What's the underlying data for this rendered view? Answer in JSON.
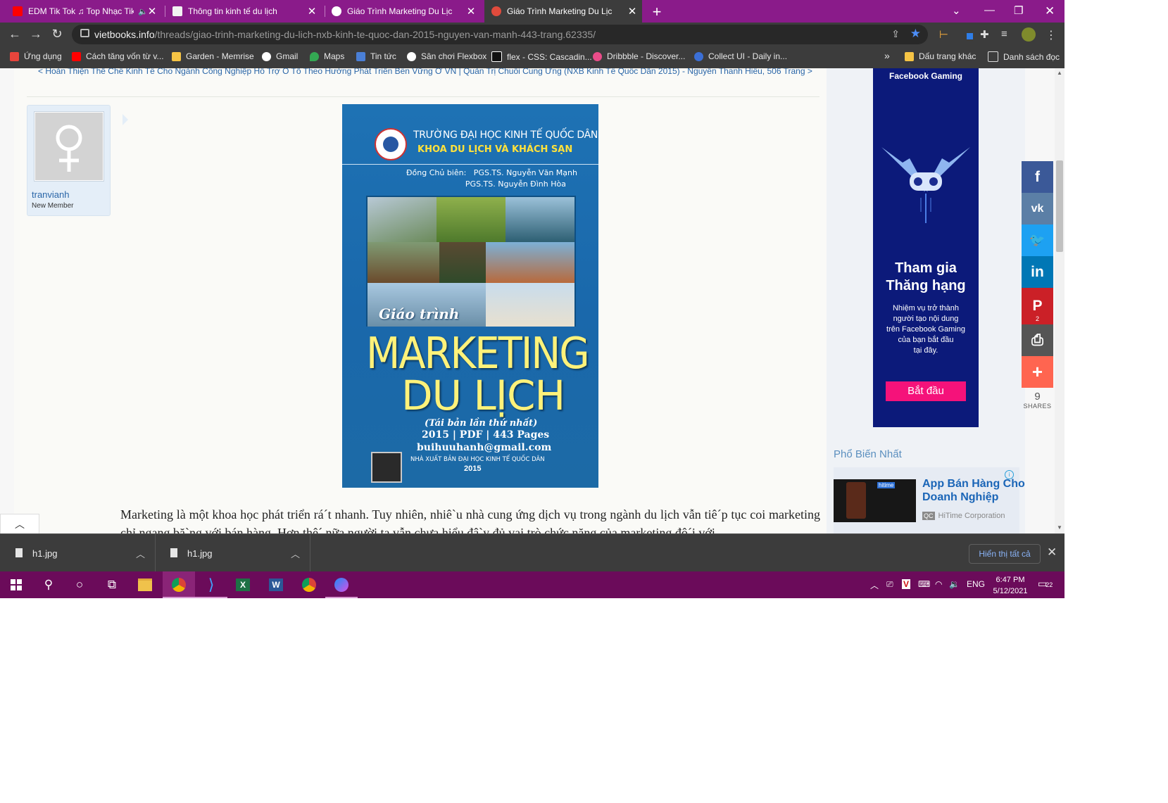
{
  "tabs": [
    {
      "title": "EDM Tik Tok ♫ Top Nhạc Tik",
      "favicon_color": "#ff0000",
      "active": false
    },
    {
      "title": "Thông tin kinh tế du lịch",
      "favicon_color": "#ffffff",
      "active": false
    },
    {
      "title": "Giáo Trình Marketing Du Lịch - N",
      "favicon_color": "#ffffff",
      "active": false
    },
    {
      "title": "Giáo Trình Marketing Du Lịch (N",
      "favicon_color": "#e04b3c",
      "active": true
    }
  ],
  "address_bar": {
    "domain": "vietbooks.info",
    "path": "/threads/giao-trinh-marketing-du-lich-nxb-kinh-te-quoc-dan-2015-nguyen-van-manh-443-trang.62335/"
  },
  "bookmarks": [
    {
      "label": "Ứng dụng",
      "icon": "apps-icon",
      "color": "#e8453c"
    },
    {
      "label": "Cách tăng vốn từ v...",
      "icon": "youtube-icon",
      "color": "#ff0000"
    },
    {
      "label": "Garden - Memrise",
      "icon": "memrise-icon",
      "color": "#f6c445"
    },
    {
      "label": "Gmail",
      "icon": "google-icon",
      "color": "#ffffff"
    },
    {
      "label": "Maps",
      "icon": "maps-icon",
      "color": "#34a853"
    },
    {
      "label": "Tin tức",
      "icon": "news-icon",
      "color": "#4a7fd6"
    },
    {
      "label": "Sân chơi Flexbox",
      "icon": "flexbox-icon",
      "color": "#ffffff"
    },
    {
      "label": "flex - CSS: Cascadin...",
      "icon": "mdn-icon",
      "color": "#111111"
    },
    {
      "label": "Dribbble - Discover...",
      "icon": "dribbble-icon",
      "color": "#ea4c89"
    },
    {
      "label": "Collect UI - Daily in...",
      "icon": "collectui-icon",
      "color": "#3b6fd6"
    }
  ],
  "bookmarks_overflow": "»",
  "other_bookmarks": "Dấu trang khác",
  "reading_list": "Danh sách đọc",
  "thread_nav": "< Hoàn Thiện Thể Chế Kinh Tế Cho Ngành Công Nghiệp Hỗ Trợ Ô Tô Theo Hướng Phát Triển Bền Vững Ở VN  |  Quản Trị Chuỗi Cung Ứng (NXB Kinh Tế Quốc Dân 2015) - Nguyễn Thanh Hiếu, 506 Trang >",
  "user": {
    "name": "tranvianh",
    "title": "New Member"
  },
  "cover": {
    "school": "TRƯỜNG ĐẠI HỌC KINH TẾ QUỐC DÂN",
    "faculty": "KHOA DU LỊCH VÀ KHÁCH SẠN",
    "editors": "Đồng Chủ biên:   PGS.TS. Nguyễn Văn Mạnh\n                        PGS.TS. Nguyễn Đình Hòa",
    "series": "Giáo trình",
    "title1": "MARKETING",
    "title2": "DU LỊCH",
    "edition": "(Tái bản lần thứ nhất)",
    "info": "2015 | PDF | 443 Pages",
    "email": "buihuuhanh@gmail.com",
    "publisher": "NHÀ XUẤT BẢN ĐẠI HỌC KINH TẾ QUỐC DÂN",
    "year": "2015"
  },
  "article_text": "Marketing là một khoa học phát triển rá´t nhanh. Tuy nhiên, nhiê`u nhà cung ứng dịch vụ trong ngành du lịch vẫn tiê´p tục coi marketing chỉ ngang bă`ng với bán hàng. Hơn thê´ nữa người ta vẫn chưa hiểu đâ`y đủ vai trò chức năng của marketing đô´i với",
  "ad_gaming": {
    "brand": "Facebook Gaming",
    "headline": "Tham gia\nThăng hạng",
    "body": "Nhiệm vụ trở thành\nngười tạo nội dung\ntrên Facebook Gaming\ncủa bạn bắt đầu\ntại đây.",
    "cta": "Bắt đầu"
  },
  "popular_heading": "Phổ Biến Nhất",
  "ad_hitime": {
    "title": "App Bán Hàng Cho\nDoanh Nghiệp",
    "badge": "QC",
    "advertiser": "HiTime Corporation",
    "thumb_brand": "hitime"
  },
  "share_buttons": [
    {
      "name": "facebook",
      "glyph": "f",
      "color": "#3b5998",
      "count": ""
    },
    {
      "name": "vk",
      "glyph": "vk",
      "color": "#5b7fa6",
      "count": ""
    },
    {
      "name": "twitter",
      "glyph": "🐦",
      "color": "#1da1f2",
      "count": ""
    },
    {
      "name": "linkedin",
      "glyph": "in",
      "color": "#0077b5",
      "count": ""
    },
    {
      "name": "pinterest",
      "glyph": "P",
      "color": "#cb2027",
      "count": "2"
    },
    {
      "name": "print",
      "glyph": "⎙",
      "color": "#555555",
      "count": ""
    },
    {
      "name": "more",
      "glyph": "+",
      "color": "#ff6550",
      "count": ""
    }
  ],
  "shares": {
    "count": "9",
    "label": "SHARES"
  },
  "downloads": [
    {
      "filename": "h1.jpg"
    },
    {
      "filename": "h1.jpg"
    }
  ],
  "downloads_show_all": "Hiển thị tất cả",
  "taskbar": {
    "language": "ENG",
    "time": "6:47 PM",
    "date": "5/12/2021",
    "notifications": "22"
  }
}
